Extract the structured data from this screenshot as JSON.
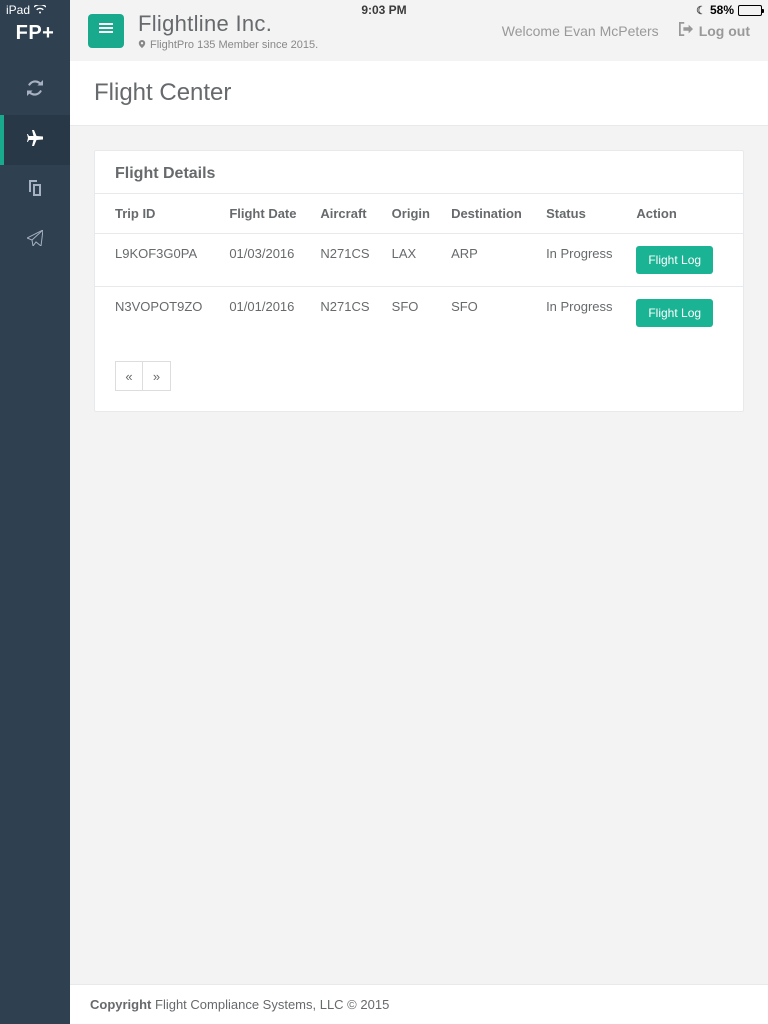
{
  "status_bar": {
    "device": "iPad",
    "time": "9:03 PM",
    "battery_pct": "58%"
  },
  "sidebar": {
    "brand": "FP+"
  },
  "topbar": {
    "company": "Flightline Inc.",
    "member_line": "FlightPro 135 Member since 2015.",
    "welcome": "Welcome Evan McPeters",
    "logout": "Log out"
  },
  "page": {
    "title": "Flight Center"
  },
  "panel": {
    "title": "Flight Details"
  },
  "table": {
    "headers": {
      "trip_id": "Trip ID",
      "flight_date": "Flight Date",
      "aircraft": "Aircraft",
      "origin": "Origin",
      "destination": "Destination",
      "status": "Status",
      "action": "Action"
    },
    "rows": [
      {
        "trip_id": "L9KOF3G0PA",
        "flight_date": "01/03/2016",
        "aircraft": "N271CS",
        "origin": "LAX",
        "destination": "ARP",
        "status": "In Progress",
        "action": "Flight Log"
      },
      {
        "trip_id": "N3VOPOT9ZO",
        "flight_date": "01/01/2016",
        "aircraft": "N271CS",
        "origin": "SFO",
        "destination": "SFO",
        "status": "In Progress",
        "action": "Flight Log"
      }
    ]
  },
  "pagination": {
    "prev": "«",
    "next": "»"
  },
  "footer": {
    "strong": "Copyright",
    "rest": " Flight Compliance Systems, LLC © 2015"
  }
}
